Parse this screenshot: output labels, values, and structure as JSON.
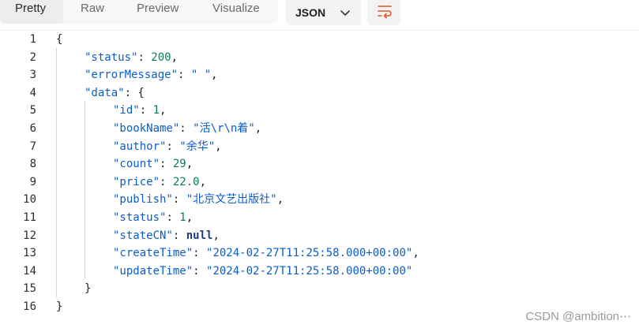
{
  "toolbar": {
    "tabs": [
      {
        "label": "Pretty",
        "active": true
      },
      {
        "label": "Raw",
        "active": false
      },
      {
        "label": "Preview",
        "active": false
      },
      {
        "label": "Visualize",
        "active": false
      }
    ],
    "format": {
      "label": "JSON",
      "icon": "chevron-down-icon"
    },
    "wrap_icon": "wrap-lines-icon"
  },
  "editor": {
    "line_numbers": [
      "1",
      "2",
      "3",
      "4",
      "5",
      "6",
      "7",
      "8",
      "9",
      "10",
      "11",
      "12",
      "13",
      "14",
      "15",
      "16"
    ],
    "lines": [
      {
        "indent": 0,
        "tokens": [
          {
            "t": "punc",
            "v": "{"
          }
        ]
      },
      {
        "indent": 1,
        "tokens": [
          {
            "t": "key",
            "v": "\"status\""
          },
          {
            "t": "punc",
            "v": ": "
          },
          {
            "t": "num",
            "v": "200"
          },
          {
            "t": "punc",
            "v": ","
          }
        ]
      },
      {
        "indent": 1,
        "tokens": [
          {
            "t": "key",
            "v": "\"errorMessage\""
          },
          {
            "t": "punc",
            "v": ": "
          },
          {
            "t": "str",
            "v": "\" \""
          },
          {
            "t": "punc",
            "v": ","
          }
        ]
      },
      {
        "indent": 1,
        "tokens": [
          {
            "t": "key",
            "v": "\"data\""
          },
          {
            "t": "punc",
            "v": ": {"
          }
        ]
      },
      {
        "indent": 2,
        "tokens": [
          {
            "t": "key",
            "v": "\"id\""
          },
          {
            "t": "punc",
            "v": ": "
          },
          {
            "t": "num",
            "v": "1"
          },
          {
            "t": "punc",
            "v": ","
          }
        ]
      },
      {
        "indent": 2,
        "tokens": [
          {
            "t": "key",
            "v": "\"bookName\""
          },
          {
            "t": "punc",
            "v": ": "
          },
          {
            "t": "str",
            "v": "\"活\\r\\n着\""
          },
          {
            "t": "punc",
            "v": ","
          }
        ]
      },
      {
        "indent": 2,
        "tokens": [
          {
            "t": "key",
            "v": "\"author\""
          },
          {
            "t": "punc",
            "v": ": "
          },
          {
            "t": "str",
            "v": "\"余华\""
          },
          {
            "t": "punc",
            "v": ","
          }
        ]
      },
      {
        "indent": 2,
        "tokens": [
          {
            "t": "key",
            "v": "\"count\""
          },
          {
            "t": "punc",
            "v": ": "
          },
          {
            "t": "num",
            "v": "29"
          },
          {
            "t": "punc",
            "v": ","
          }
        ]
      },
      {
        "indent": 2,
        "tokens": [
          {
            "t": "key",
            "v": "\"price\""
          },
          {
            "t": "punc",
            "v": ": "
          },
          {
            "t": "num",
            "v": "22.0"
          },
          {
            "t": "punc",
            "v": ","
          }
        ]
      },
      {
        "indent": 2,
        "tokens": [
          {
            "t": "key",
            "v": "\"publish\""
          },
          {
            "t": "punc",
            "v": ": "
          },
          {
            "t": "str",
            "v": "\"北京文艺出版社\""
          },
          {
            "t": "punc",
            "v": ","
          }
        ]
      },
      {
        "indent": 2,
        "tokens": [
          {
            "t": "key",
            "v": "\"status\""
          },
          {
            "t": "punc",
            "v": ": "
          },
          {
            "t": "num",
            "v": "1"
          },
          {
            "t": "punc",
            "v": ","
          }
        ]
      },
      {
        "indent": 2,
        "tokens": [
          {
            "t": "key",
            "v": "\"stateCN\""
          },
          {
            "t": "punc",
            "v": ": "
          },
          {
            "t": "kw",
            "v": "null"
          },
          {
            "t": "punc",
            "v": ","
          }
        ]
      },
      {
        "indent": 2,
        "tokens": [
          {
            "t": "key",
            "v": "\"createTime\""
          },
          {
            "t": "punc",
            "v": ": "
          },
          {
            "t": "str",
            "v": "\"2024-02-27T11:25:58.000+00:00\""
          },
          {
            "t": "punc",
            "v": ","
          }
        ]
      },
      {
        "indent": 2,
        "tokens": [
          {
            "t": "key",
            "v": "\"updateTime\""
          },
          {
            "t": "punc",
            "v": ": "
          },
          {
            "t": "str",
            "v": "\"2024-02-27T11:25:58.000+00:00\""
          }
        ]
      },
      {
        "indent": 1,
        "tokens": [
          {
            "t": "punc",
            "v": "}"
          }
        ]
      },
      {
        "indent": 0,
        "tokens": [
          {
            "t": "punc",
            "v": "}"
          }
        ]
      }
    ]
  },
  "watermark": "CSDN @ambition⋯"
}
